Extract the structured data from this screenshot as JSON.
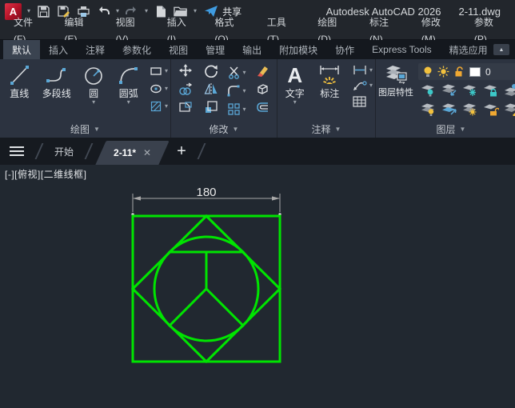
{
  "titlebar": {
    "logo_letter": "A",
    "app_title": "Autodesk AutoCAD 2026",
    "doc_title": "2-11.dwg",
    "share_label": "共享",
    "qat_icons": [
      "app-logo",
      "logo-dropdown",
      "save-icon",
      "save-as-icon",
      "plot-icon",
      "undo-icon",
      "undo-dropdown",
      "redo-icon",
      "redo-dropdown",
      "new-file-icon",
      "open-folder-icon",
      "qat-customize-dropdown",
      "share-plane-icon"
    ]
  },
  "menubar": {
    "items": [
      "文件(F)",
      "编辑(E)",
      "视图(V)",
      "插入(I)",
      "格式(O)",
      "工具(T)",
      "绘图(D)",
      "标注(N)",
      "修改(M)",
      "参数(P)"
    ]
  },
  "ribbon": {
    "tabs": [
      "默认",
      "插入",
      "注释",
      "参数化",
      "视图",
      "管理",
      "输出",
      "附加模块",
      "协作",
      "Express Tools",
      "精选应用"
    ],
    "active_tab": "默认",
    "panels": [
      {
        "title": "绘图",
        "big_buttons": [
          "直线",
          "多段线",
          "圆",
          "圆弧"
        ],
        "small_icons": [
          "rectangle-icon",
          "ellipse-icon",
          "hatch-icon"
        ]
      },
      {
        "title": "修改",
        "icons": [
          "move-icon",
          "rotate-icon",
          "trim-icon",
          "erase-icon",
          "copy-icon",
          "mirror-icon",
          "fillet-icon",
          "explode-icon",
          "stretch-icon",
          "scale-icon",
          "array-icon",
          "offset-icon"
        ]
      },
      {
        "title": "注释",
        "big_buttons": [
          "文字",
          "标注"
        ],
        "text_glyph": "A",
        "small_icons": [
          "linear-dimension-icon",
          "leader-icon",
          "table-icon"
        ]
      },
      {
        "title": "图层",
        "properties_button": "图层特性",
        "layer_combo": {
          "layer_name": "0",
          "icons": [
            "bulb-on-icon",
            "sun-icon",
            "unlock-icon",
            "color-swatch"
          ]
        },
        "tool_icons": [
          "layer-off-icon",
          "layer-isolate-icon",
          "layer-freeze-icon",
          "layer-lock-icon",
          "layer-make-current-icon",
          "layer-on-all-icon",
          "layer-unisolate-icon",
          "layer-thaw-all-icon",
          "layer-unlock-icon",
          "layer-match-icon"
        ]
      }
    ]
  },
  "doctabs": {
    "tabs": [
      {
        "label": "开始",
        "active": false
      },
      {
        "label": "2-11*",
        "active": true,
        "closable": true
      }
    ]
  },
  "viewport": {
    "label": "[-][俯视][二维线框]"
  },
  "drawing": {
    "dimension_text": "180",
    "square_size_units": 180,
    "entities": [
      "outer-square",
      "inscribed-diamond",
      "inscribed-circle",
      "top-chord",
      "vertical-radius",
      "lower-left-radius",
      "lower-right-radius",
      "linear-dimension"
    ],
    "colors": {
      "geometry": "#00e400",
      "dimension_line": "#a8a8a8",
      "dimension_text": "#e8e8e8",
      "background": "#212830"
    }
  }
}
